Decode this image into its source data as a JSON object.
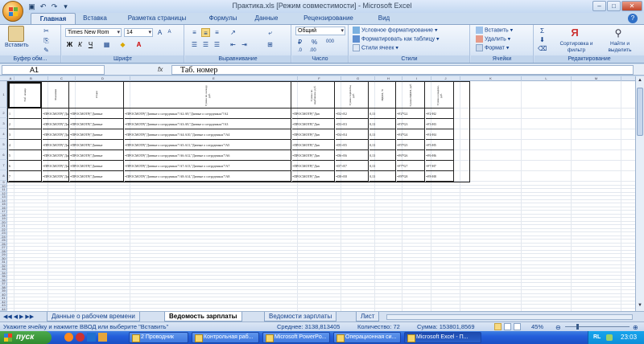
{
  "window": {
    "title": "Практика.xls  [Режим совместимости] - Microsoft Excel",
    "controls": [
      "–",
      "□",
      "✕"
    ]
  },
  "ribbon_tabs": [
    "Главная",
    "Вставка",
    "Разметка страницы",
    "Формулы",
    "Данные",
    "Рецензирование",
    "Вид"
  ],
  "ribbon": {
    "clipboard": {
      "paste": "Вставить",
      "label": "Буфер обм..."
    },
    "font": {
      "name": "Times New Rom",
      "size": "14",
      "label": "Шрифт",
      "bold": "Ж",
      "italic": "К",
      "underline": "Ч"
    },
    "alignment": {
      "label": "Выравнивание"
    },
    "number": {
      "format": "Общий",
      "label": "Число",
      "percent": "%",
      "thousands": "000"
    },
    "styles": {
      "conditional": "Условное форматирование",
      "as_table": "Форматировать как таблицу",
      "cell_styles": "Стили ячеек",
      "label": "Стили"
    },
    "cells": {
      "insert": "Вставить",
      "delete": "Удалить",
      "format": "Формат",
      "label": "Ячейки"
    },
    "editing": {
      "sort": "Сортировка и фильтр",
      "find": "Найти и выделить",
      "label": "Редактирование"
    }
  },
  "formula_bar": {
    "name_box": "A1",
    "fx": "fx",
    "content": "Таб. номер"
  },
  "columns": [
    "A",
    "B",
    "C",
    "D",
    "E",
    "F",
    "G",
    "H",
    "I",
    "J",
    "K",
    "L",
    "M",
    "N"
  ],
  "table": {
    "headers": [
      "Таб. номер",
      "Фамилия",
      "Отдел",
      "Сумма по окладу, руб.",
      "Сумма по надбавкам, руб.",
      "Сумма зарплаты, руб.",
      "НДФЛ, %",
      "Сумма НДФЛ, руб.",
      "Сумма к выдаче, руб."
    ],
    "rows": [
      [
        "1",
        "=ПРОСМОТР(\"Данные о",
        "=ПРОСМОТР(\"Данные",
        "=ПРОСМОТР(\"Данные о сотрудниках\"!A2:A9,\"Данные о сотрудниках\"!A2",
        "=ПРОСМОТР(\"Дан",
        "=D2+E2",
        "0,13",
        "=F2*G2",
        "=F2-H2"
      ],
      [
        "2",
        "=ПРОСМОТР(\"Данные о",
        "=ПРОСМОТР(\"Данные",
        "=ПРОСМОТР(\"Данные о сотрудниках\"!A3:A9,\"Данные о сотрудниках\"!A3",
        "=ПРОСМОТР(\"Дан",
        "=D3+E3",
        "0,13",
        "=F3*G3",
        "=F3-H3"
      ],
      [
        "3",
        "=ПРОСМОТР(\"Данные о",
        "=ПРОСМОТР(\"Данные",
        "=ПРОСМОТР(\"Данные о сотрудниках\"!A4:A10,\"Данные о сотрудниках\"!A4",
        "=ПРОСМОТР(\"Дан",
        "=D4+E4",
        "0,13",
        "=F4*G4",
        "=F4-H4"
      ],
      [
        "4",
        "=ПРОСМОТР(\"Данные о",
        "=ПРОСМОТР(\"Данные",
        "=ПРОСМОТР(\"Данные о сотрудниках\"!A5:A11,\"Данные о сотрудниках\"!A5",
        "=ПРОСМОТР(\"Дан",
        "=D5+E5",
        "0,13",
        "=F5*G5",
        "=F5-H5"
      ],
      [
        "5",
        "=ПРОСМОТР(\"Данные о",
        "=ПРОСМОТР(\"Данные",
        "=ПРОСМОТР(\"Данные о сотрудниках\"!A6:A12,\"Данные о сотрудниках\"!A6",
        "=ПРОСМОТР(\"Дан",
        "=D6+E6",
        "0,13",
        "=F6*G6",
        "=F6-H6"
      ],
      [
        "6",
        "=ПРОСМОТР(\"Данные о",
        "=ПРОСМОТР(\"Данные",
        "=ПРОСМОТР(\"Данные о сотрудниках\"!A7:A13,\"Данные о сотрудниках\"!A7",
        "=ПРОСМОТР(\"Дан",
        "=D7+E7",
        "0,13",
        "=F7*G7",
        "=F7-H7"
      ],
      [
        "7",
        "=ПРОСМОТР(\"Данные о",
        "=ПРОСМОТР(\"Данные",
        "=ПРОСМОТР(\"Данные о сотрудниках\"!A8:A14,\"Данные о сотрудниках\"!A8",
        "=ПРОСМОТР(\"Дан",
        "=D8+E8",
        "0,13",
        "=F8*G8",
        "=F8-H8"
      ]
    ]
  },
  "sheet_tabs": [
    "Данные о рабочем времени",
    "Ведомость зарплаты",
    "Ведомости зарплаты",
    "Лист"
  ],
  "active_sheet": "Ведомость зарплаты",
  "status": {
    "message": "Укажите ячейку и нажмите ВВОД или выберите \"Вставить\"",
    "average": "Среднее: 3138,813405",
    "count": "Количество: 72",
    "sum": "Сумма: 153801,8569",
    "zoom": "45%"
  },
  "taskbar": {
    "start": "пуск",
    "items": [
      "2 Проводник",
      "Контрольная раб...",
      "Microsoft PowerPo...",
      "Операционная си...",
      "Microsoft Excel - П..."
    ],
    "lang": "RL",
    "time": "23:03"
  }
}
